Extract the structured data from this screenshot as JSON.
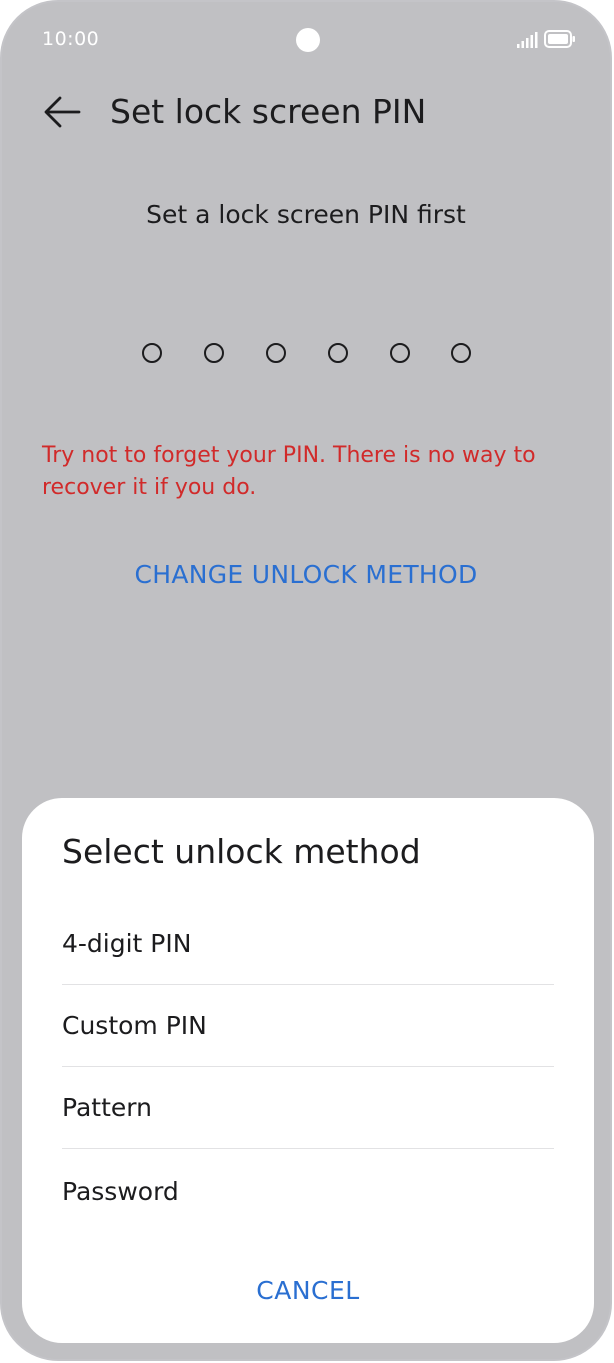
{
  "status_bar": {
    "time": "10:00",
    "signal_icon": "signal-icon",
    "battery_icon": "battery-icon"
  },
  "header": {
    "back_icon": "arrow-left-icon",
    "title": "Set lock screen PIN"
  },
  "main": {
    "subtitle": "Set a lock screen PIN first",
    "pin_length": 6,
    "warning": "Try not to forget your PIN. There is no way to recover it if you do.",
    "change_method_label": "CHANGE UNLOCK METHOD"
  },
  "sheet": {
    "title": "Select unlock method",
    "options": [
      {
        "label": "4-digit PIN"
      },
      {
        "label": "Custom PIN"
      },
      {
        "label": "Pattern"
      },
      {
        "label": "Password"
      }
    ],
    "cancel_label": "CANCEL"
  },
  "colors": {
    "background_dim": "#c0c0c3",
    "warning": "#d12a2a",
    "accent": "#2a6fd1",
    "text": "#1c1c1e"
  }
}
